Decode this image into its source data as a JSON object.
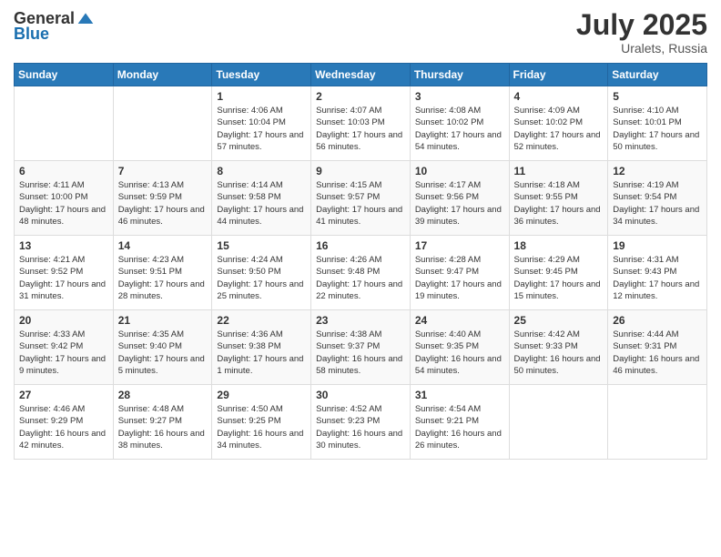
{
  "logo": {
    "general": "General",
    "blue": "Blue"
  },
  "title": {
    "month_year": "July 2025",
    "location": "Uralets, Russia"
  },
  "headers": [
    "Sunday",
    "Monday",
    "Tuesday",
    "Wednesday",
    "Thursday",
    "Friday",
    "Saturday"
  ],
  "weeks": [
    [
      {
        "day": "",
        "info": ""
      },
      {
        "day": "",
        "info": ""
      },
      {
        "day": "1",
        "info": "Sunrise: 4:06 AM\nSunset: 10:04 PM\nDaylight: 17 hours and 57 minutes."
      },
      {
        "day": "2",
        "info": "Sunrise: 4:07 AM\nSunset: 10:03 PM\nDaylight: 17 hours and 56 minutes."
      },
      {
        "day": "3",
        "info": "Sunrise: 4:08 AM\nSunset: 10:02 PM\nDaylight: 17 hours and 54 minutes."
      },
      {
        "day": "4",
        "info": "Sunrise: 4:09 AM\nSunset: 10:02 PM\nDaylight: 17 hours and 52 minutes."
      },
      {
        "day": "5",
        "info": "Sunrise: 4:10 AM\nSunset: 10:01 PM\nDaylight: 17 hours and 50 minutes."
      }
    ],
    [
      {
        "day": "6",
        "info": "Sunrise: 4:11 AM\nSunset: 10:00 PM\nDaylight: 17 hours and 48 minutes."
      },
      {
        "day": "7",
        "info": "Sunrise: 4:13 AM\nSunset: 9:59 PM\nDaylight: 17 hours and 46 minutes."
      },
      {
        "day": "8",
        "info": "Sunrise: 4:14 AM\nSunset: 9:58 PM\nDaylight: 17 hours and 44 minutes."
      },
      {
        "day": "9",
        "info": "Sunrise: 4:15 AM\nSunset: 9:57 PM\nDaylight: 17 hours and 41 minutes."
      },
      {
        "day": "10",
        "info": "Sunrise: 4:17 AM\nSunset: 9:56 PM\nDaylight: 17 hours and 39 minutes."
      },
      {
        "day": "11",
        "info": "Sunrise: 4:18 AM\nSunset: 9:55 PM\nDaylight: 17 hours and 36 minutes."
      },
      {
        "day": "12",
        "info": "Sunrise: 4:19 AM\nSunset: 9:54 PM\nDaylight: 17 hours and 34 minutes."
      }
    ],
    [
      {
        "day": "13",
        "info": "Sunrise: 4:21 AM\nSunset: 9:52 PM\nDaylight: 17 hours and 31 minutes."
      },
      {
        "day": "14",
        "info": "Sunrise: 4:23 AM\nSunset: 9:51 PM\nDaylight: 17 hours and 28 minutes."
      },
      {
        "day": "15",
        "info": "Sunrise: 4:24 AM\nSunset: 9:50 PM\nDaylight: 17 hours and 25 minutes."
      },
      {
        "day": "16",
        "info": "Sunrise: 4:26 AM\nSunset: 9:48 PM\nDaylight: 17 hours and 22 minutes."
      },
      {
        "day": "17",
        "info": "Sunrise: 4:28 AM\nSunset: 9:47 PM\nDaylight: 17 hours and 19 minutes."
      },
      {
        "day": "18",
        "info": "Sunrise: 4:29 AM\nSunset: 9:45 PM\nDaylight: 17 hours and 15 minutes."
      },
      {
        "day": "19",
        "info": "Sunrise: 4:31 AM\nSunset: 9:43 PM\nDaylight: 17 hours and 12 minutes."
      }
    ],
    [
      {
        "day": "20",
        "info": "Sunrise: 4:33 AM\nSunset: 9:42 PM\nDaylight: 17 hours and 9 minutes."
      },
      {
        "day": "21",
        "info": "Sunrise: 4:35 AM\nSunset: 9:40 PM\nDaylight: 17 hours and 5 minutes."
      },
      {
        "day": "22",
        "info": "Sunrise: 4:36 AM\nSunset: 9:38 PM\nDaylight: 17 hours and 1 minute."
      },
      {
        "day": "23",
        "info": "Sunrise: 4:38 AM\nSunset: 9:37 PM\nDaylight: 16 hours and 58 minutes."
      },
      {
        "day": "24",
        "info": "Sunrise: 4:40 AM\nSunset: 9:35 PM\nDaylight: 16 hours and 54 minutes."
      },
      {
        "day": "25",
        "info": "Sunrise: 4:42 AM\nSunset: 9:33 PM\nDaylight: 16 hours and 50 minutes."
      },
      {
        "day": "26",
        "info": "Sunrise: 4:44 AM\nSunset: 9:31 PM\nDaylight: 16 hours and 46 minutes."
      }
    ],
    [
      {
        "day": "27",
        "info": "Sunrise: 4:46 AM\nSunset: 9:29 PM\nDaylight: 16 hours and 42 minutes."
      },
      {
        "day": "28",
        "info": "Sunrise: 4:48 AM\nSunset: 9:27 PM\nDaylight: 16 hours and 38 minutes."
      },
      {
        "day": "29",
        "info": "Sunrise: 4:50 AM\nSunset: 9:25 PM\nDaylight: 16 hours and 34 minutes."
      },
      {
        "day": "30",
        "info": "Sunrise: 4:52 AM\nSunset: 9:23 PM\nDaylight: 16 hours and 30 minutes."
      },
      {
        "day": "31",
        "info": "Sunrise: 4:54 AM\nSunset: 9:21 PM\nDaylight: 16 hours and 26 minutes."
      },
      {
        "day": "",
        "info": ""
      },
      {
        "day": "",
        "info": ""
      }
    ]
  ]
}
